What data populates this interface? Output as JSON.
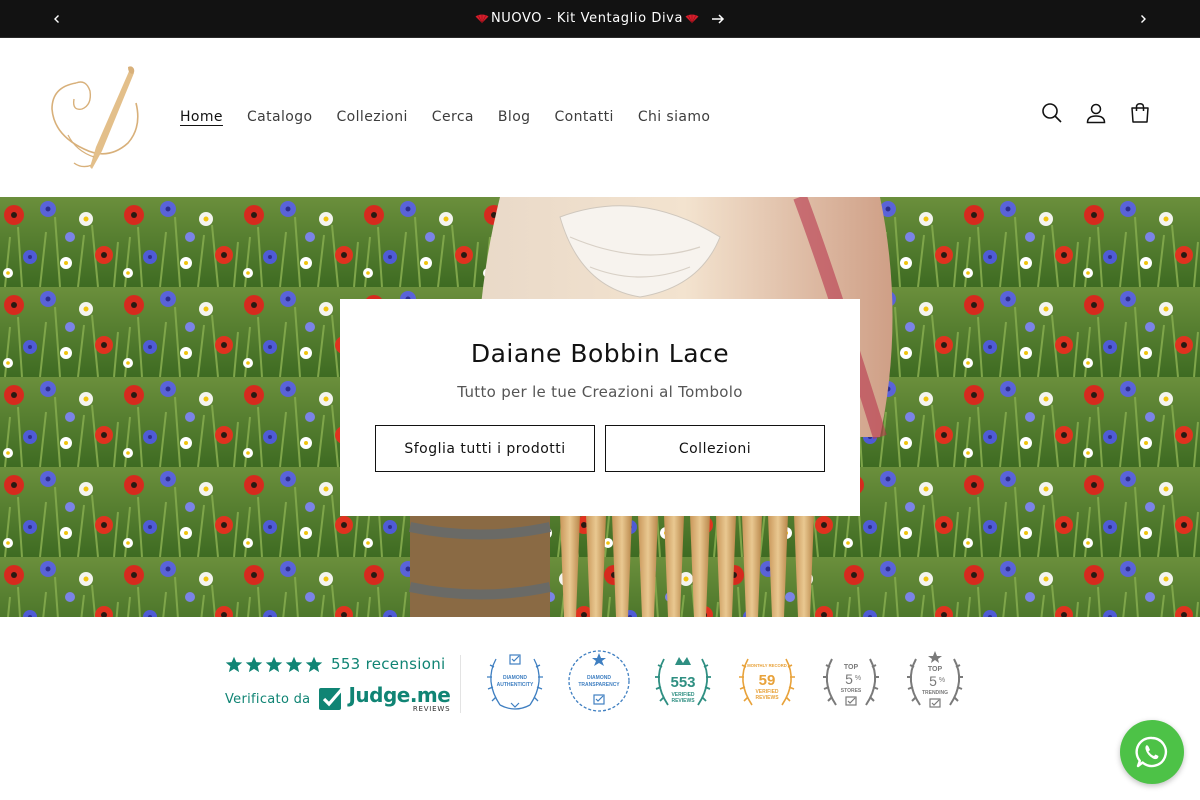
{
  "announcement": {
    "text": "NUOVO - Kit Ventaglio Diva",
    "prev_icon": "chevron-left-icon",
    "next_icon": "chevron-right-icon",
    "arrow_icon": "arrow-right-icon",
    "fan_color": "#d81e2c"
  },
  "header": {
    "logo_icon": "daiane-logo-icon",
    "nav": [
      {
        "label": "Home",
        "active": true
      },
      {
        "label": "Catalogo"
      },
      {
        "label": "Collezioni"
      },
      {
        "label": "Cerca"
      },
      {
        "label": "Blog"
      },
      {
        "label": "Contatti"
      },
      {
        "label": "Chi siamo"
      }
    ],
    "icons": [
      "search-icon",
      "account-icon",
      "cart-icon"
    ]
  },
  "hero": {
    "title": "Daiane Bobbin Lace",
    "subtitle": "Tutto per le tue Creazioni al Tombolo",
    "buttons": [
      {
        "label": "Sfoglia tutti i prodotti"
      },
      {
        "label": "Collezioni"
      }
    ]
  },
  "reviews": {
    "rating_stars": 5,
    "count_label": "553 recensioni",
    "verified_label": "Verificato da",
    "brand_name": "Judge.me",
    "brand_sub": "REVIEWS",
    "accent_color": "#108474",
    "badges": [
      {
        "top": "",
        "big": "",
        "line1": "DIAMOND",
        "line2": "AUTHENTICITY",
        "color": "#3f7fc1"
      },
      {
        "top": "",
        "big": "",
        "line1": "DIAMOND",
        "line2": "TRANSPARENCY",
        "color": "#3f7fc1"
      },
      {
        "top": "",
        "big": "553",
        "line1": "VERIFIED",
        "line2": "REVIEWS",
        "color": "#2f8f82"
      },
      {
        "top": "MONTHLY RECORD",
        "big": "59",
        "line1": "VERIFIED",
        "line2": "REVIEWS",
        "color": "#e8a23a"
      },
      {
        "top": "TOP",
        "big": "5",
        "pct": "%",
        "line1": "STORES",
        "line2": "",
        "color": "#7a7a7a"
      },
      {
        "top": "TOP",
        "big": "5",
        "pct": "%",
        "line1": "TRENDING",
        "line2": "",
        "color": "#7a7a7a"
      }
    ]
  },
  "whatsapp": {
    "icon": "whatsapp-icon",
    "color": "#4dc247"
  }
}
